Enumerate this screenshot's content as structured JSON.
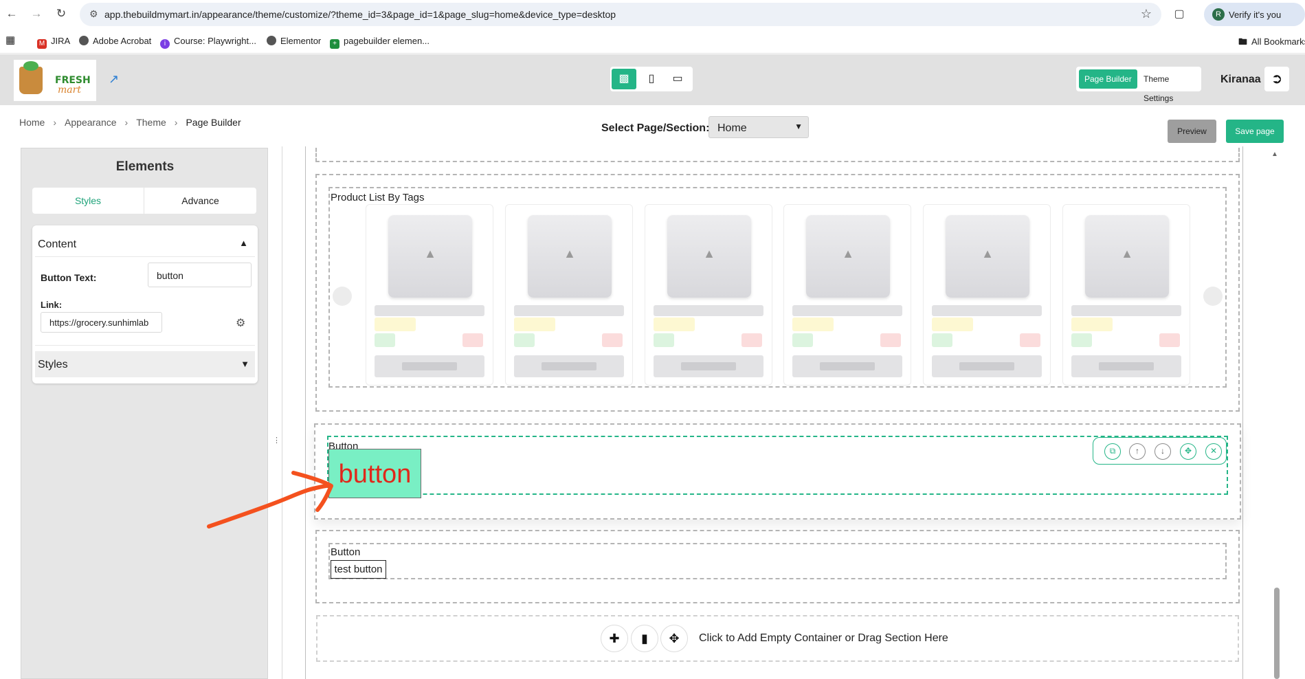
{
  "browser": {
    "url": "app.thebuildmymart.in/appearance/theme/customize/?theme_id=3&page_id=1&page_slug=home&device_type=desktop",
    "profile_label": "Verify it's you",
    "profile_initial": "R"
  },
  "bookmarks": [
    {
      "label": "JIRA",
      "color": "#d93025"
    },
    {
      "label": "Adobe Acrobat",
      "color": "#555555"
    },
    {
      "label": "Course: Playwright...",
      "color": "#7b3fe4"
    },
    {
      "label": "Elementor",
      "color": "#555555"
    },
    {
      "label": "pagebuilder elemen...",
      "color": "#1e8e3e"
    }
  ],
  "bookmarks_right": "All Bookmarks",
  "header": {
    "logo_fresh": "FRESH",
    "logo_mart": "mart",
    "page_builder_label": "Page Builder",
    "theme_settings_label": "Theme Settings",
    "store_name": "Kiranaa"
  },
  "breadcrumb": [
    "Home",
    "Appearance",
    "Theme",
    "Page Builder"
  ],
  "page_select": {
    "label": "Select Page/Section:",
    "value": "Home"
  },
  "actions": {
    "preview": "Preview",
    "save": "Save page"
  },
  "left_panel": {
    "title": "Elements",
    "tabs": [
      "Styles",
      "Advance"
    ],
    "content_heading": "Content",
    "button_text_label": "Button Text:",
    "button_text_value": "button",
    "link_label": "Link:",
    "link_value": "https://grocery.sunhimlab",
    "styles_heading": "Styles"
  },
  "canvas": {
    "product_section_label": "Product List By Tags",
    "product_card_count": 6,
    "selected_section_label": "Button",
    "selected_button_text": "button",
    "second_section_label": "Button",
    "second_button_text": "test button",
    "add_container_text": "Click to Add Empty Container or Drag Section Here"
  },
  "colors": {
    "accent": "#24b587",
    "selected_button_bg": "#79efc4",
    "selected_button_text": "#e0281b",
    "annotation_arrow": "#f4511e"
  }
}
